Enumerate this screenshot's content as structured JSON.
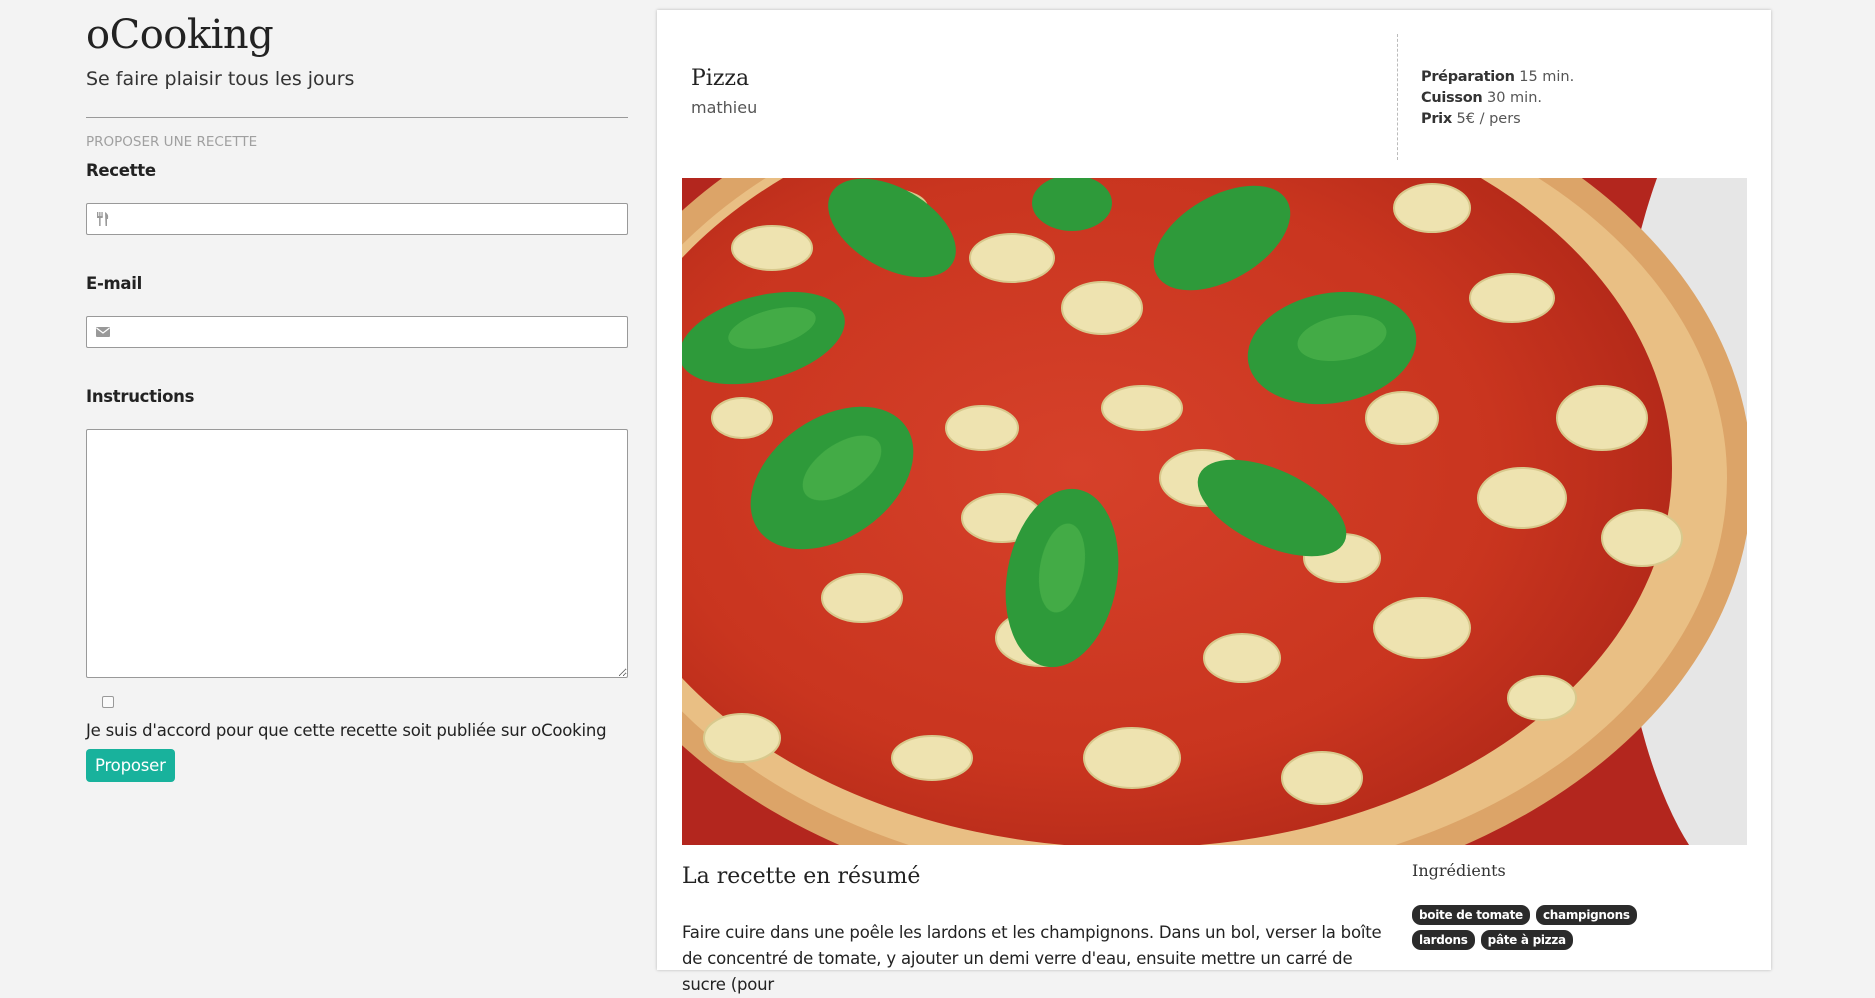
{
  "sidebar": {
    "brand": "oCooking",
    "tagline": "Se faire plaisir tous les jours",
    "section_title": "PROPOSER UNE RECETTE",
    "recipe_label": "Recette",
    "recipe_value": "",
    "recipe_icon": "utensils-icon",
    "email_label": "E-mail",
    "email_value": "",
    "email_icon": "envelope-icon",
    "instructions_label": "Instructions",
    "instructions_value": "",
    "consent_checked": false,
    "consent_text": "Je suis d'accord pour que cette recette soit publiée sur oCooking",
    "submit_label": "Proposer",
    "accent_color": "#18b29c"
  },
  "recipe": {
    "title": "Pizza",
    "author": "mathieu",
    "prep_label": "Préparation",
    "prep_value": "15 min.",
    "cook_label": "Cuisson",
    "cook_value": "30 min.",
    "price_label": "Prix",
    "price_value": "5€ / pers",
    "summary_title": "La recette en résumé",
    "summary_text": "Faire cuire dans une poêle les lardons et les champignons.  Dans un bol, verser la boîte de concentré de tomate, y ajouter un demi verre d'eau, ensuite mettre un carré de sucre (pour",
    "ingredients_title": "Ingrédients",
    "ingredients": [
      "boite de tomate",
      "champignons",
      "lardons",
      "pâte à pizza"
    ]
  }
}
